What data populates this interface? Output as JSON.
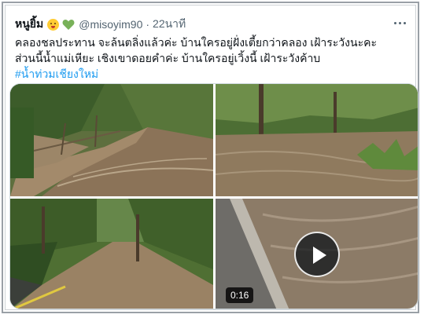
{
  "tweet": {
    "display_name": "หนูยิ้ม",
    "handle": "@misoyim90",
    "separator": "·",
    "time": "22นาที",
    "text_line_1": "คลองชลประทาน จะล้นตลิ่งแล้วค่ะ บ้านใครอยู่ฝั่งเตี้ยกว่าคลอง เฝ้าระวังนะคะ",
    "text_line_2": "ส่วนนี้น้ำแม่เหียะ เชิงเขาดอยคำค่ะ บ้านใครอยู่เวิ้งนี้ เฝ้าระวังค้าบ",
    "hashtag": "#น้ำท่วมเชียงใหม่",
    "emoji_1": "baby-face-icon",
    "emoji_2": "green-heart-icon"
  },
  "media": {
    "video_duration": "0:16",
    "play_icon": "play-icon"
  },
  "colors": {
    "link": "#1d9bf0",
    "secondary_text": "#536471",
    "primary_text": "#0f1419",
    "heart_green": "#78b159"
  }
}
